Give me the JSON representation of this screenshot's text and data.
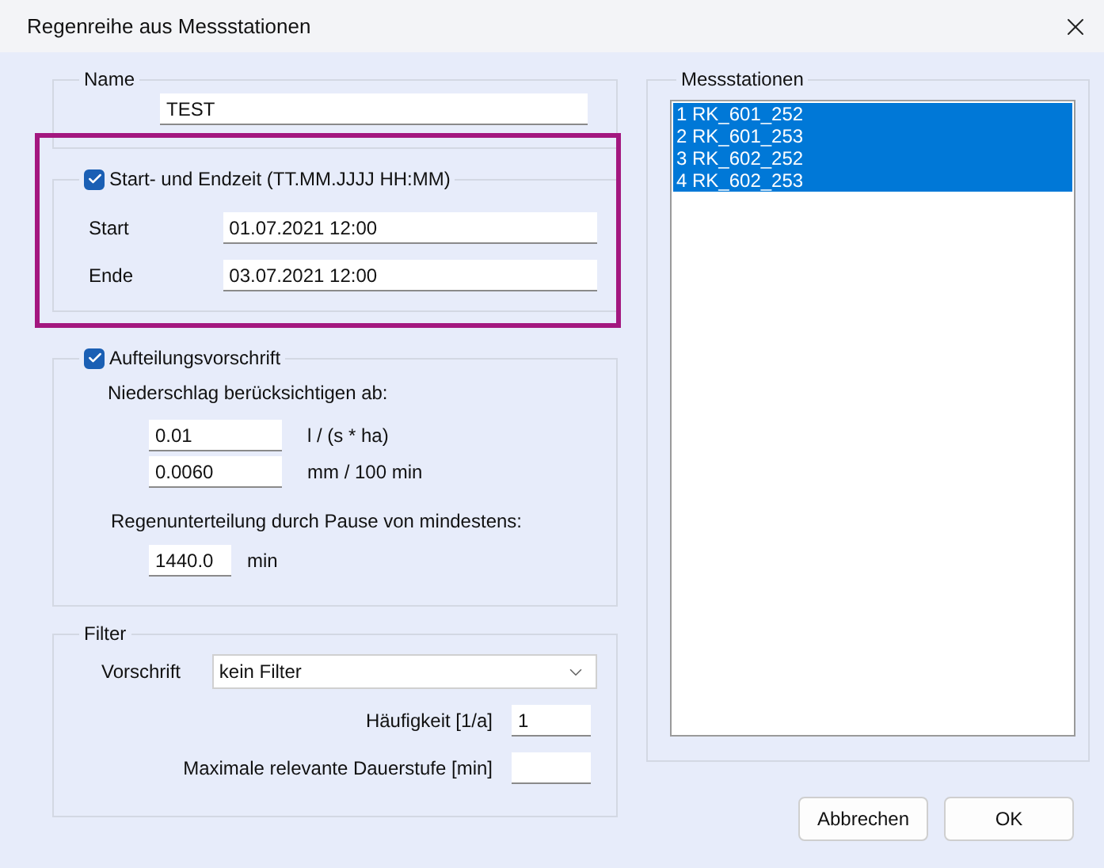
{
  "window": {
    "title": "Regenreihe aus Messstationen"
  },
  "name_group": {
    "legend": "Name",
    "value": "TEST"
  },
  "time_group": {
    "legend": "Start- und Endzeit (TT.MM.JJJJ HH:MM)",
    "checked": true,
    "highlighted": true,
    "rows": [
      {
        "label": "Start",
        "value": "01.07.2021 12:00"
      },
      {
        "label": "Ende",
        "value": "03.07.2021 12:00"
      }
    ]
  },
  "split_group": {
    "legend": "Aufteilungsvorschrift",
    "checked": true,
    "precip_label": "Niederschlag berücksichtigen ab:",
    "precip_fields": [
      {
        "value": "0.01",
        "unit": "l / (s * ha)"
      },
      {
        "value": "0.0060",
        "unit": "mm / 100 min"
      }
    ],
    "pause_label": "Regenunterteilung durch Pause von mindestens:",
    "pause_value": "1440.0",
    "pause_unit": "min"
  },
  "filter_group": {
    "legend": "Filter",
    "rule_label": "Vorschrift",
    "rule_value": "kein Filter",
    "frequency_label": "Häufigkeit [1/a]",
    "frequency_value": "1",
    "max_duration_label": "Maximale relevante Dauerstufe [min]"
  },
  "stations": {
    "legend": "Messstationen",
    "items": [
      {
        "label": "1 RK_601_252",
        "selected": true
      },
      {
        "label": "2 RK_601_253",
        "selected": true
      },
      {
        "label": "3 RK_602_252",
        "selected": true
      },
      {
        "label": "4 RK_602_253",
        "selected": true
      }
    ]
  },
  "buttons": [
    {
      "label": "Abbrechen"
    },
    {
      "label": "OK"
    }
  ]
}
